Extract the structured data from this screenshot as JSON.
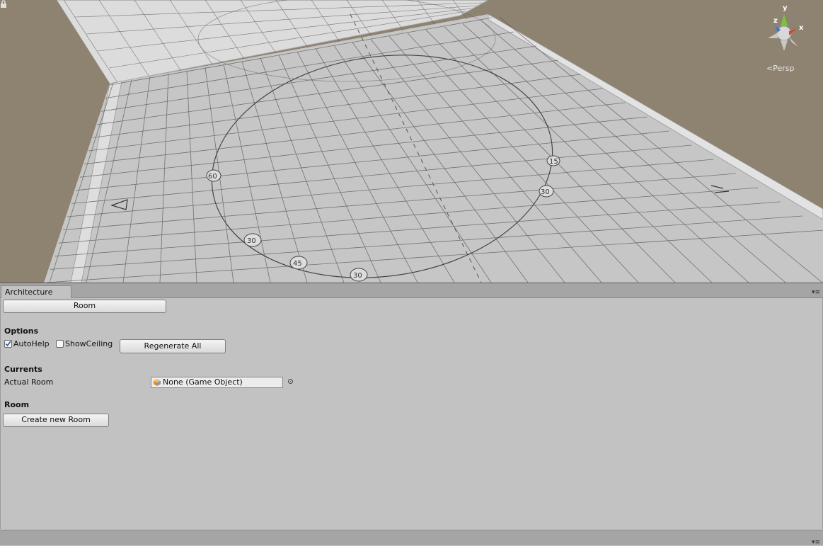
{
  "scene_view": {
    "projection_label": "Persp",
    "gizmo_axes": [
      "y",
      "z",
      "x"
    ],
    "floor_markings": [
      "30",
      "45",
      "60",
      "30",
      "30",
      "15"
    ]
  },
  "editor_window": {
    "tab_title": "Architecture",
    "room_button": "Room",
    "options": {
      "heading": "Options",
      "autohelp_label": "AutoHelp",
      "autohelp_checked": true,
      "showceiling_label": "ShowCeiling",
      "showceiling_checked": false,
      "regenerate_button": "Regenerate All"
    },
    "currents": {
      "heading": "Currents",
      "actual_room_label": "Actual Room",
      "actual_room_value": "None (Game Object)"
    },
    "room_section": {
      "heading": "Room",
      "create_button": "Create new Room"
    }
  },
  "colors": {
    "scene_background": "#8e8270",
    "panel_background": "#c2c2c2",
    "floor": "#c4c4c4",
    "wall": "#d8d8d8",
    "axis_x": "#d9432b",
    "axis_y": "#7cc43a",
    "axis_z": "#3d77d1"
  }
}
